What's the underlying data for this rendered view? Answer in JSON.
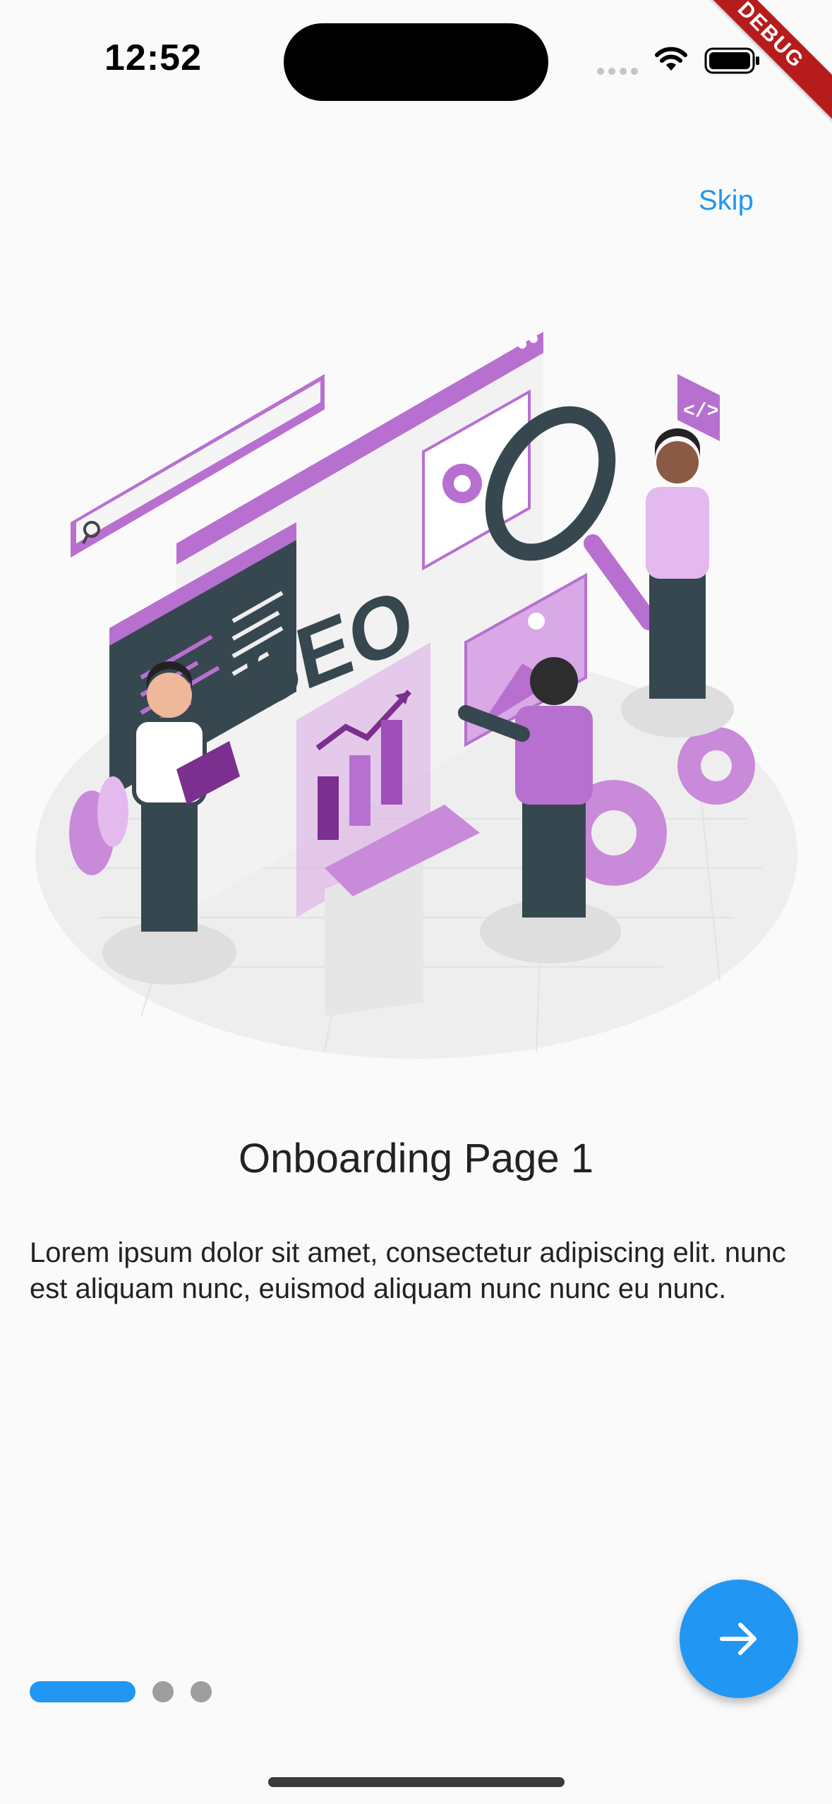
{
  "status_bar": {
    "time": "12:52"
  },
  "debug_banner": "DEBUG",
  "skip_label": "Skip",
  "illustration": {
    "banner_text": "SEO"
  },
  "page": {
    "title": "Onboarding Page 1",
    "description": "Lorem ipsum dolor sit amet, consectetur adipiscing elit. nunc est aliquam nunc, euismod aliquam nunc nunc eu nunc."
  },
  "indicator": {
    "total_pages": 3,
    "current_page": 1
  },
  "colors": {
    "accent": "#2196f3",
    "illustration_purple": "#b770d0",
    "inactive_dot": "#9e9e9e",
    "debug_banner": "#b71c1c"
  },
  "icons": {
    "next": "arrow-right-icon",
    "wifi": "wifi-icon",
    "battery": "battery-icon",
    "signal": "cellular-signal-icon"
  }
}
